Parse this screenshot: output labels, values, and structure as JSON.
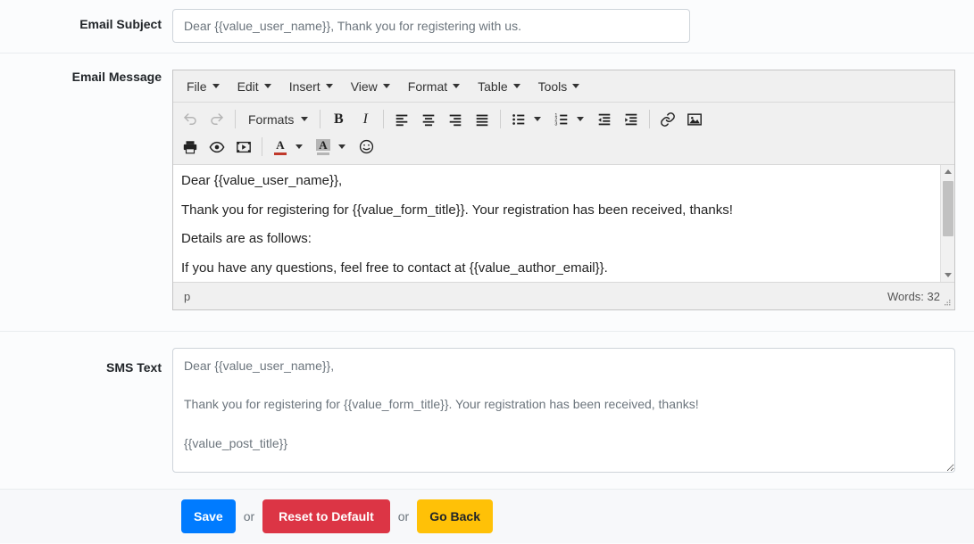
{
  "fields": {
    "email_subject": {
      "label": "Email Subject",
      "value": "Dear {{value_user_name}}, Thank you for registering with us."
    },
    "email_message": {
      "label": "Email Message"
    },
    "sms_text": {
      "label": "SMS Text",
      "value": "Dear {{value_user_name}},\n\nThank you for registering for {{value_form_title}}. Your registration has been received, thanks!\n\n{{value_post_title}}"
    }
  },
  "editor": {
    "menubar": [
      {
        "label": "File",
        "icon": "chevron-down-icon"
      },
      {
        "label": "Edit",
        "icon": "chevron-down-icon"
      },
      {
        "label": "Insert",
        "icon": "chevron-down-icon"
      },
      {
        "label": "View",
        "icon": "chevron-down-icon"
      },
      {
        "label": "Format",
        "icon": "chevron-down-icon"
      },
      {
        "label": "Table",
        "icon": "chevron-down-icon"
      },
      {
        "label": "Tools",
        "icon": "chevron-down-icon"
      }
    ],
    "toolbar_row1": {
      "undo": "undo-icon",
      "redo": "redo-icon",
      "formats_label": "Formats",
      "bold": "B",
      "italic": "I",
      "align_left": "align-left-icon",
      "align_center": "align-center-icon",
      "align_right": "align-right-icon",
      "align_justify": "align-justify-icon",
      "bullet_list": "bullet-list-icon",
      "numbered_list": "numbered-list-icon",
      "outdent": "outdent-icon",
      "indent": "indent-icon",
      "link": "link-icon",
      "image": "image-icon"
    },
    "toolbar_row2": {
      "print": "print-icon",
      "preview": "preview-eye-icon",
      "media": "media-icon",
      "forecolor": "A",
      "backcolor": "A",
      "emoticon": "emoticon-icon"
    },
    "content": [
      "Dear {{value_user_name}},",
      "Thank you for registering for {{value_form_title}}. Your registration has been received, thanks!",
      "Details are as follows:",
      "If you have any questions, feel free to contact at {{value_author_email}}."
    ],
    "statusbar": {
      "element_path": "p",
      "word_count": "Words: 32"
    }
  },
  "footer": {
    "save_label": "Save",
    "or_1": "or",
    "reset_label": "Reset to Default",
    "or_2": "or",
    "back_label": "Go Back"
  },
  "colors": {
    "save": "#007bff",
    "reset": "#dc3545",
    "back": "#ffc107",
    "forecolor_swatch": "#c0392b",
    "toolbar_bg": "#f0f0f0"
  }
}
